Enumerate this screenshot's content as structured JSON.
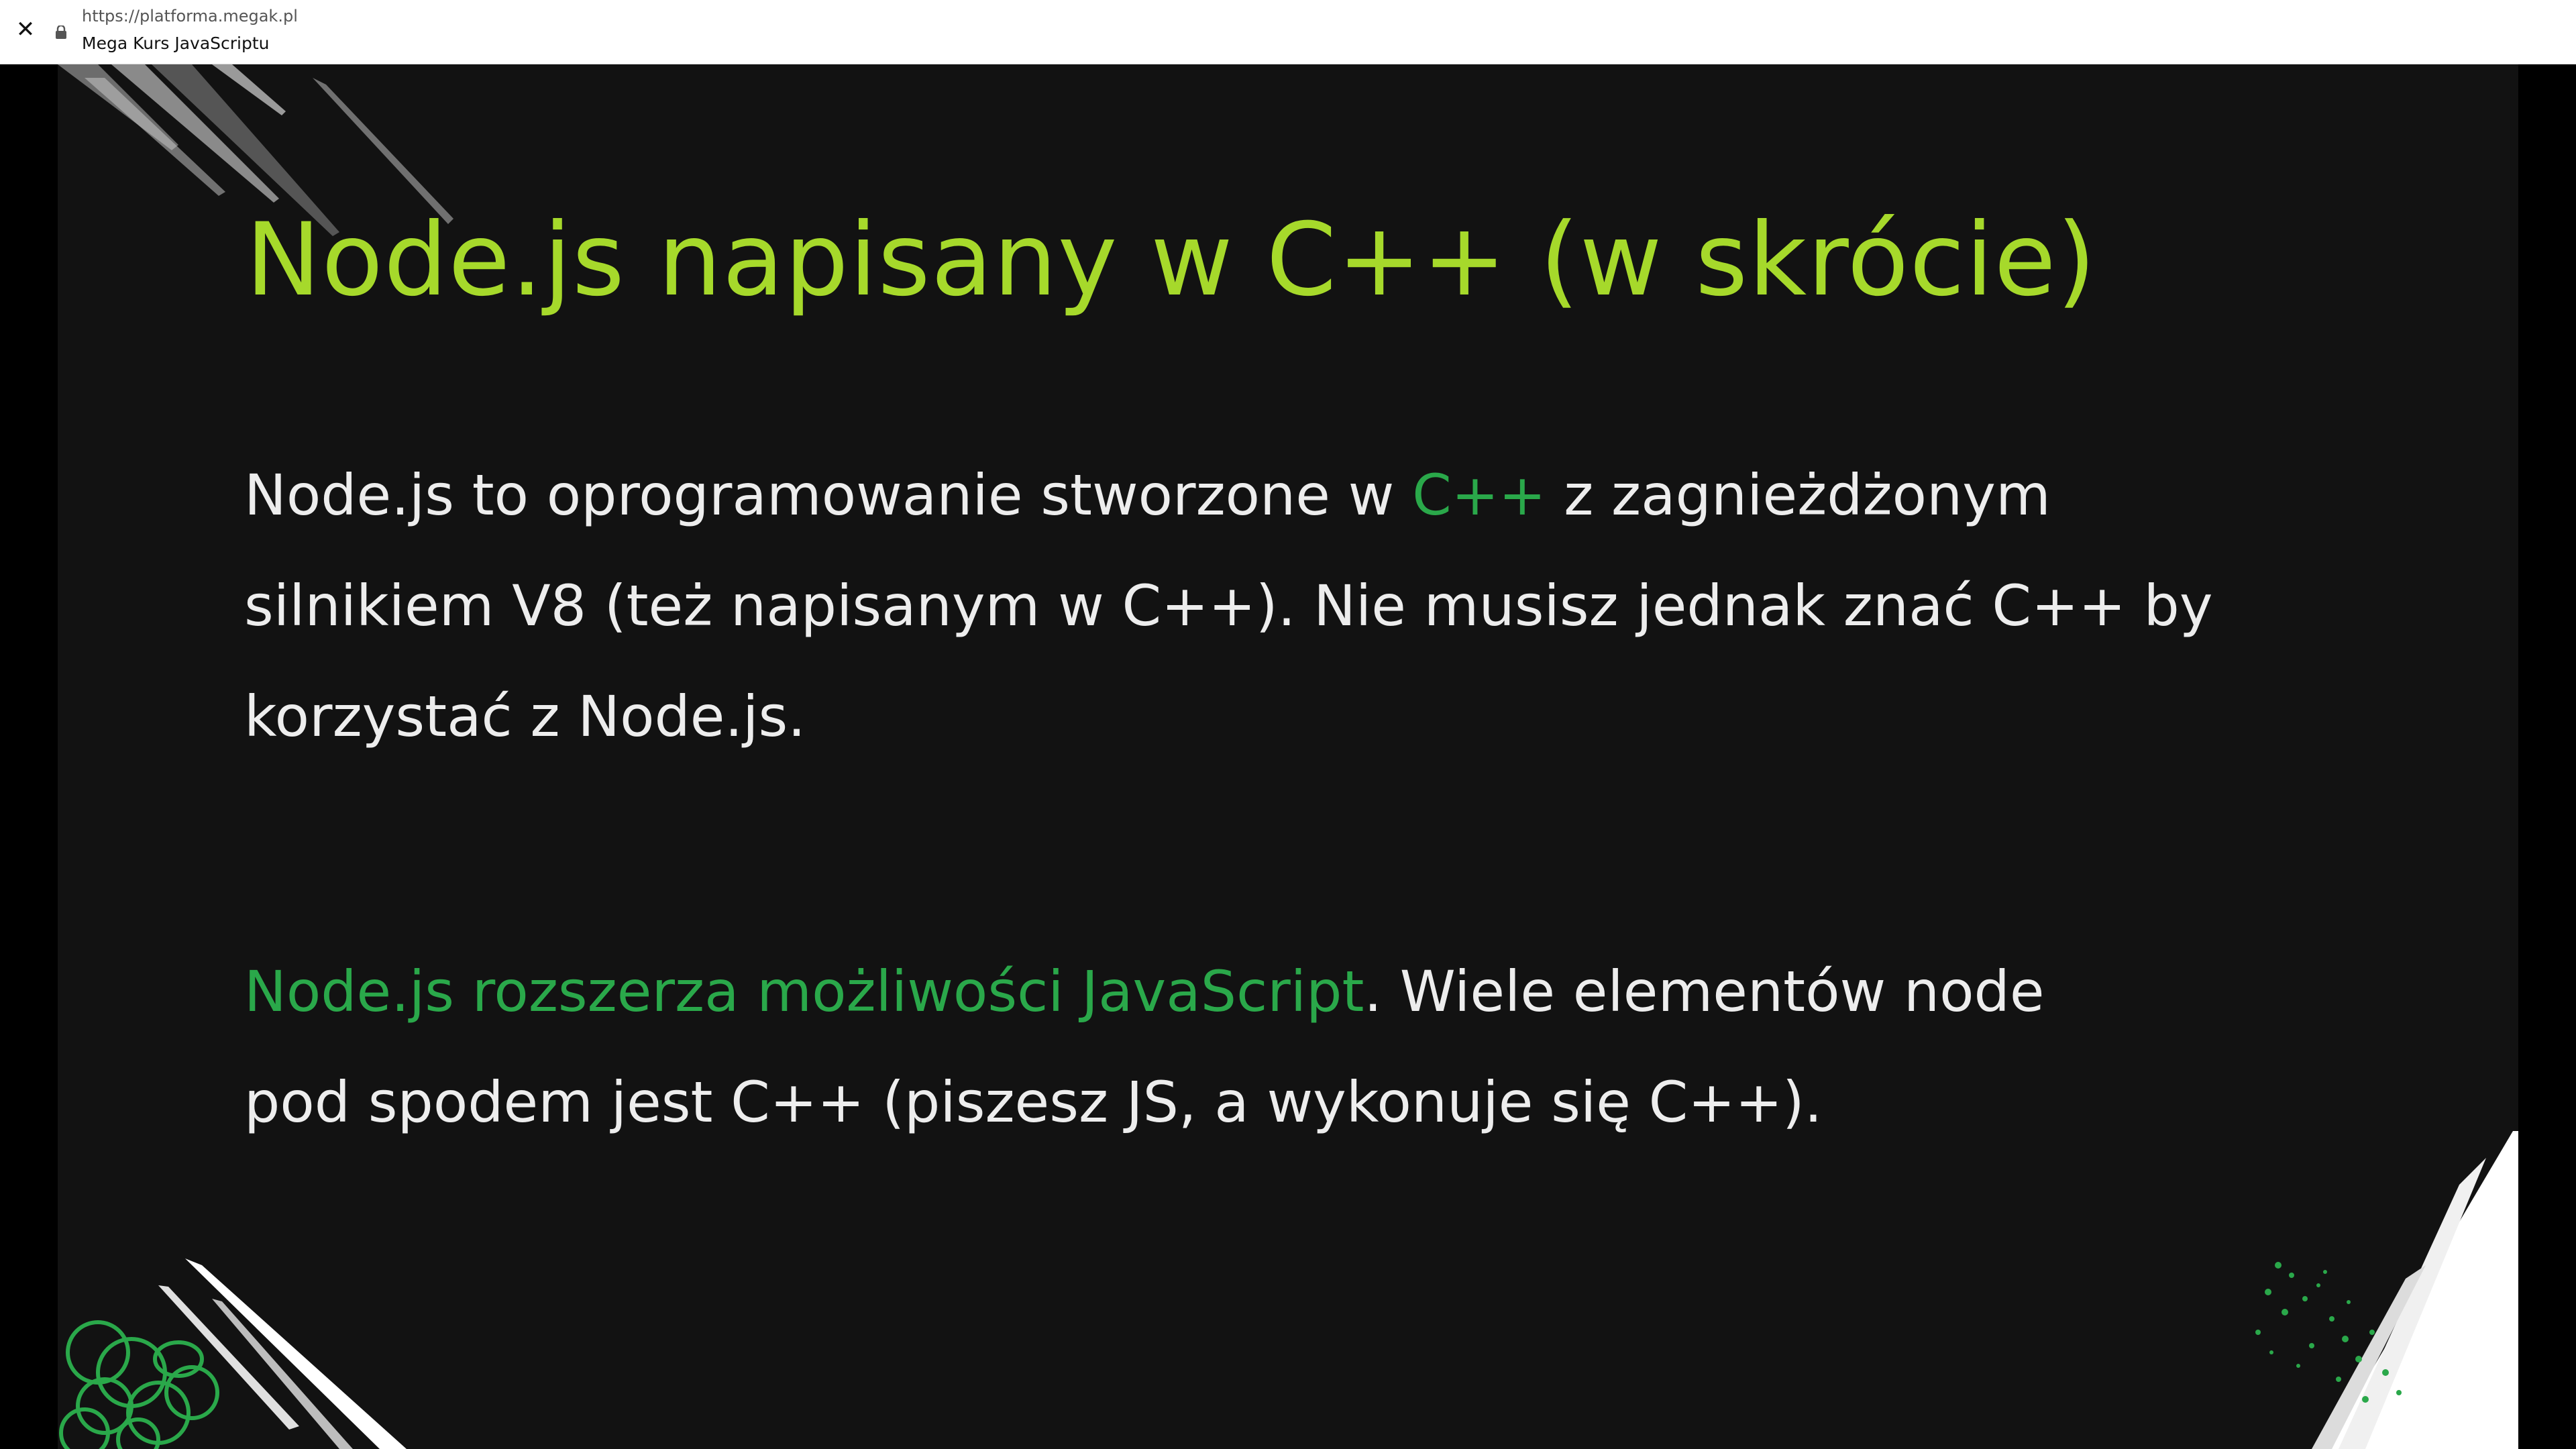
{
  "browser": {
    "url": "https://platforma.megak.pl",
    "page_title": "Mega Kurs JavaScriptu",
    "close_symbol": "✕"
  },
  "slide": {
    "title": "Node.js napisany w C++ (w skrócie)",
    "paragraph1": {
      "part1": "Node.js to oprogramowanie stworzone w ",
      "highlight": "C++",
      "part2_line1_rest": " z zagnieżdżonym",
      "line2": "silnikiem V8 (też napisanym w C++). Nie musisz jednak znać C++ by",
      "line3": "korzystać z Node.js."
    },
    "paragraph2": {
      "highlight": "Node.js rozszerza możliwości JavaScript",
      "part1_rest": ". Wiele elementów node",
      "line2": "pod spodem jest C++ (piszesz JS, a wykonuje się C++)."
    }
  },
  "colors": {
    "title": "#a6d92b",
    "highlight": "#2aa84a",
    "body_text": "#ededed",
    "slide_bg": "#121212"
  }
}
